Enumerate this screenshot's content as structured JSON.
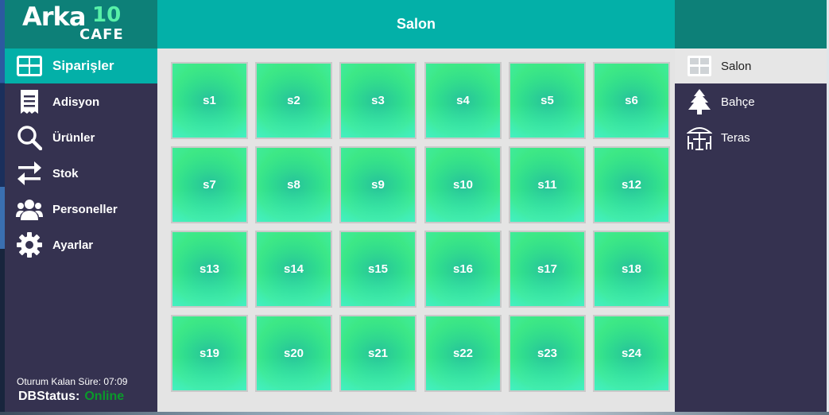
{
  "logo": {
    "brand": "Arka",
    "number": "10",
    "sub": "CAFE"
  },
  "header": {
    "title": "Salon"
  },
  "sidebar": {
    "items": [
      {
        "label": "Siparişler",
        "icon": "grid-icon",
        "active": true
      },
      {
        "label": "Adisyon",
        "icon": "receipt-icon"
      },
      {
        "label": "Ürünler",
        "icon": "search-icon"
      },
      {
        "label": "Stok",
        "icon": "transfer-arrows-icon"
      },
      {
        "label": "Personeller",
        "icon": "users-icon"
      },
      {
        "label": "Ayarlar",
        "icon": "gear-icon"
      }
    ],
    "session_text": "Oturum Kalan Süre: 07:09",
    "db_status_label": "DBStatus:",
    "db_status_value": "Online"
  },
  "tables": [
    "s1",
    "s2",
    "s3",
    "s4",
    "s5",
    "s6",
    "s7",
    "s8",
    "s9",
    "s10",
    "s11",
    "s12",
    "s13",
    "s14",
    "s15",
    "s16",
    "s17",
    "s18",
    "s19",
    "s20",
    "s21",
    "s22",
    "s23",
    "s24"
  ],
  "areas": [
    {
      "label": "Salon",
      "icon": "grid-icon",
      "active": true
    },
    {
      "label": "Bahçe",
      "icon": "tree-icon"
    },
    {
      "label": "Teras",
      "icon": "table-umbrella-icon"
    }
  ],
  "colors": {
    "accent": "#03b0a8",
    "dark_teal": "#0d8078",
    "sidebar_bg": "#353250",
    "table_green": "#3be88a",
    "online": "#0a9a2a"
  }
}
